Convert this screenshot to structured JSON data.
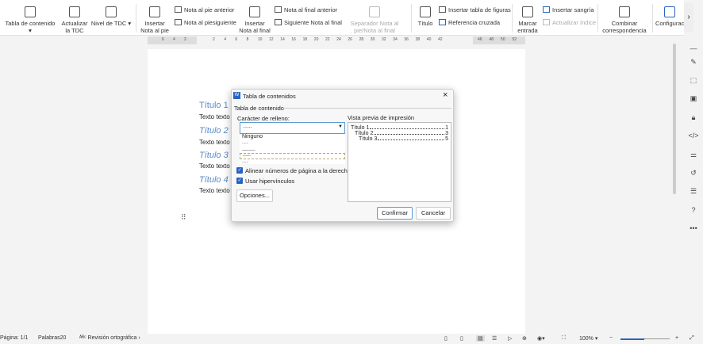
{
  "ribbon": {
    "toc": "Tabla de contenido ▾",
    "update_toc": "Actualizar la TDC",
    "toc_level": "Nivel de TDC ▾",
    "insert_footnote": "Insertar Nota al pie",
    "prev_footnote": "Nota al pie anterior",
    "next_footnote": "Nota al piesiguiente",
    "insert_endnote": "Insertar Nota al final",
    "prev_endnote": "Nota al final anterior",
    "next_endnote": "Siguiente Nota al final",
    "separator": "Separador Nota al pie/Nota al final",
    "caption": "Título",
    "insert_figures_table": "Insertar tabla de figuras",
    "cross_ref": "Referencia cruzada",
    "mark_entry": "Marcar entrada",
    "insert_indent": "Insertar sangría",
    "update_index": "Actualizar índice",
    "mail_merge": "Combinar correspondencia",
    "settings": "Configurac"
  },
  "ruler": {
    "ticks": [
      "6",
      "4",
      "2",
      "2",
      "4",
      "6",
      "8",
      "10",
      "12",
      "14",
      "16",
      "18",
      "20",
      "22",
      "24",
      "26",
      "28",
      "30",
      "32",
      "34",
      "36",
      "38",
      "40",
      "42",
      "46",
      "48",
      "50",
      "52"
    ]
  },
  "document": {
    "headings": [
      "Título 1",
      "Título 2",
      "Título 3",
      "Título 4"
    ],
    "body": "Texto texto"
  },
  "dialog": {
    "title": "Tabla de contenidos",
    "group": "Tabla de contenido",
    "fill_label": "Carácter de relleno:",
    "fill_value": "......",
    "options": [
      "Ninguno",
      "......",
      "______",
      "------",
      "......"
    ],
    "align_label": "Alinear números de página a la derecha",
    "hyperlinks_label": "Usar hipervínculos",
    "options_button": "Opciones...",
    "preview_label": "Vista previa de impresión",
    "preview": [
      {
        "t": "Título 1",
        "p": "1"
      },
      {
        "t": "Título 2",
        "p": "3"
      },
      {
        "t": "Título 3",
        "p": "5"
      }
    ],
    "confirm": "Confirmar",
    "cancel": "Cancelar"
  },
  "status": {
    "page": "Página: 1/1",
    "words": "Palabras20",
    "spell": "Revisión ortográfica",
    "zoom": "100%"
  }
}
